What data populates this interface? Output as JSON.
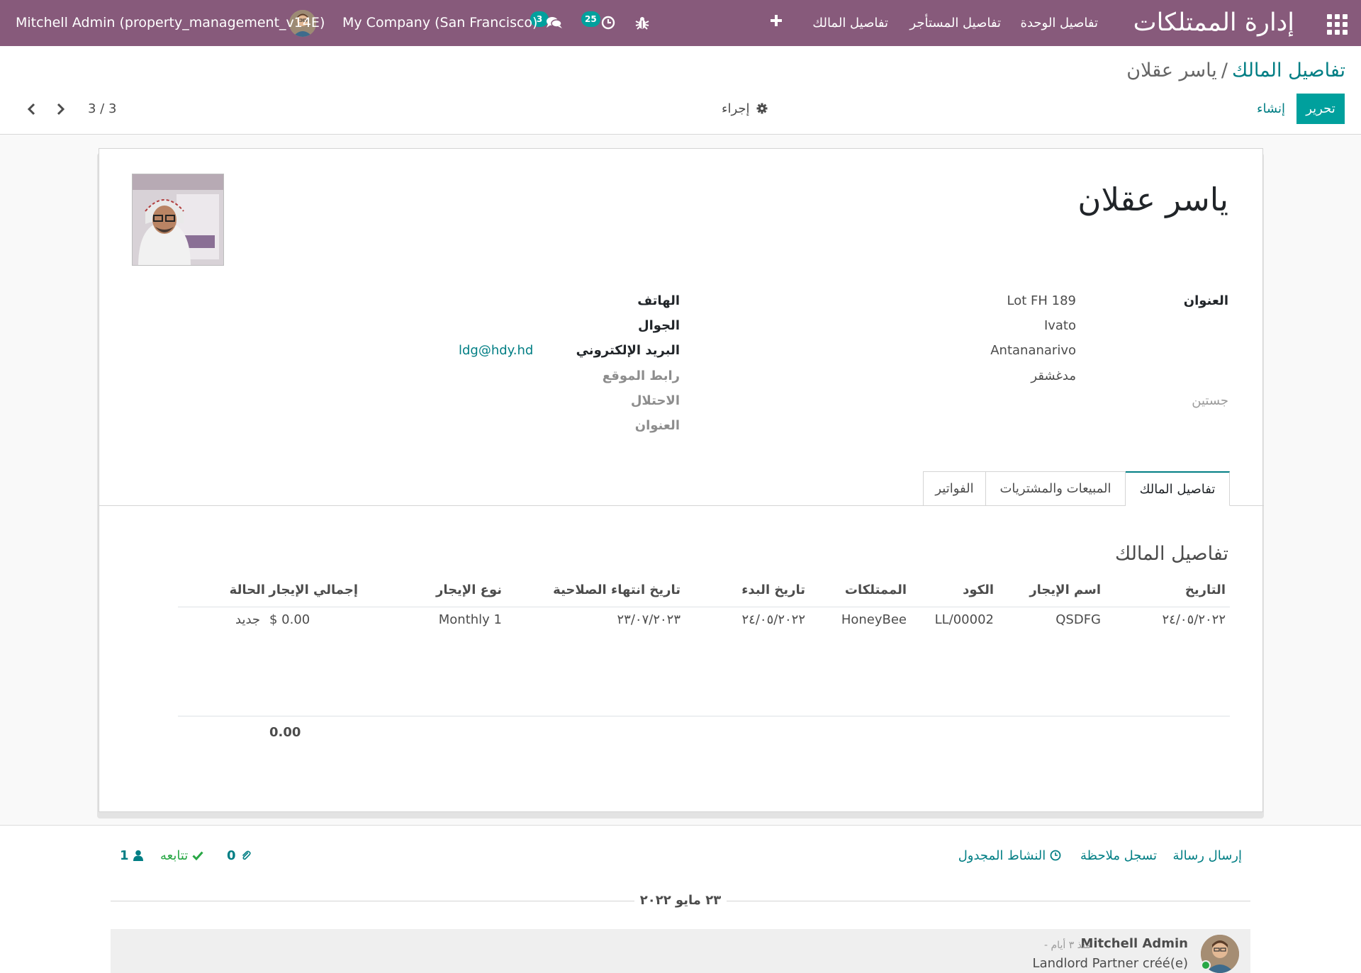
{
  "navbar": {
    "app_title": "إدارة الممتلكات",
    "menu": [
      "تفاصيل الوحدة",
      "تفاصيل المستأجر",
      "تفاصيل المالك"
    ],
    "chat_badge": "3",
    "activity_badge": "25",
    "company": "My Company (San Francisco)",
    "user": "Mitchell Admin (property_management_v14E)"
  },
  "control_panel": {
    "breadcrumb_parent": "تفاصيل المالك",
    "breadcrumb_separator": "/",
    "breadcrumb_current": "ياسر عقلان",
    "edit_label": "تحرير",
    "create_label": "إنشاء",
    "action_label": "إجراء",
    "pager": "3 / 3"
  },
  "form": {
    "name": "ياسر عقلان",
    "address_label": "العنوان",
    "address_lines": [
      "Lot FH 189",
      "Ivato",
      "Antananarivo",
      "مدغشقر"
    ],
    "tags_placeholder": "جستين",
    "phone_label": "الهاتف",
    "mobile_label": "الجوال",
    "email_label": "البريد الإلكتروني",
    "email_value": "ldg@hdy.hd",
    "website_label": "رابط الموقع",
    "occupation_label": "الاحتلال",
    "second_address_label": "العنوان"
  },
  "tabs": [
    "تفاصيل المالك",
    "المبيعات والمشتريات",
    "الفواتير"
  ],
  "section_title": "تفاصيل المالك",
  "table": {
    "headers": [
      "التاريخ",
      "اسم الإيجار",
      "الكود",
      "الممتلكات",
      "تاريخ البدء",
      "تاريخ انتهاء الصلاحية",
      "نوع الإيجار",
      "إجمالي الإيجار",
      "الحالة"
    ],
    "rows": [
      [
        "٢٤/٠٥/٢٠٢٢",
        "QSDFG",
        "LL/00002",
        "HoneyBee",
        "٢٤/٠٥/٢٠٢٢",
        "٢٣/٠٧/٢٠٢٣",
        "Monthly 1",
        "$ 0.00",
        "جديد"
      ]
    ],
    "total": "0.00"
  },
  "chatter": {
    "send_message": "إرسال رسالة",
    "log_note": "تسجل ملاحظة",
    "schedule_activity": "النشاط المجدول",
    "attachments_count": "0",
    "follow_label": "تتابعه",
    "followers_count": "1",
    "date_separator": "٢٣ مايو ٢٠٢٢",
    "message": {
      "author": "Mitchell Admin",
      "date": "- منذ ٣ أيام",
      "body": "Landlord Partner créé(e)"
    }
  },
  "colors": {
    "navbar": "#875a7b",
    "primary": "#00a09d",
    "link": "#017e84",
    "follow": "#28a745"
  }
}
